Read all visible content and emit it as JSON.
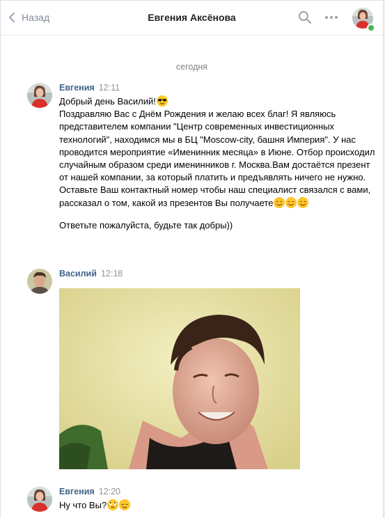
{
  "header": {
    "back_label": "Назад",
    "title": "Евгения Аксёнова"
  },
  "date_separator": "сегодня",
  "messages": [
    {
      "author": "Евгения",
      "time": "12:11",
      "lines": [
        "Добрый день Василий!",
        "Поздравляю Вас с Днём Рождения и желаю всех благ! Я являюсь представителем компании \"Центр современных инвестиционных технологий\", находимся мы в БЦ \"Moscow-city, башня Империя\". У нас проводится мероприятие «Именинник месяца» в Июне. Отбор происходил случайным образом среди именинников г. Москва.Вам достаётся презент от нашей компании, за который платить и предъявлять ничего не нужно. Оставьте Ваш контактный номер чтобы наш специалист связался с вами, рассказал о том, какой из презентов Вы получаете",
        "Ответьте пожалуйста, будьте так добры))"
      ]
    },
    {
      "author": "Василий",
      "time": "12:18",
      "attachment": "photo"
    },
    {
      "author": "Евгения",
      "time": "12:20",
      "lines": [
        "Ну что Вы?"
      ]
    }
  ],
  "colors": {
    "link": "#42648b",
    "muted": "#939393",
    "online": "#4bb34b",
    "emoji": "#fdc72b"
  },
  "icons": [
    "chevron-left-icon",
    "search-icon",
    "more-icon",
    "sunglasses-emoji",
    "smile-emoji",
    "rolling-eyes-emoji",
    "relieved-emoji"
  ]
}
